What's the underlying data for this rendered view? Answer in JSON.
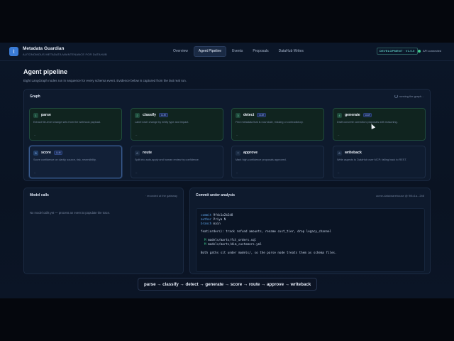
{
  "app": {
    "title": "Metadata Guardian",
    "subtitle": "AUTONOMOUS METADATA MAINTENANCE FOR DATAHUB",
    "logo_glyph": "⌇",
    "env_badge": "DEVELOPMENT · V1.0.0",
    "api_status": "API connected",
    "status_color": "#3ecf8e"
  },
  "nav": {
    "tabs": [
      {
        "label": "Overview",
        "active": false
      },
      {
        "label": "Agent Pipeline",
        "active": true
      },
      {
        "label": "Events",
        "active": false
      },
      {
        "label": "Proposals",
        "active": false
      },
      {
        "label": "DataHub Writes",
        "active": false
      }
    ]
  },
  "page": {
    "title": "Agent pipeline",
    "description": "Eight LangGraph nodes run in sequence for every schema event. Evidence below is captured from the last real run."
  },
  "graph": {
    "label": "Graph",
    "status": "running the graph…",
    "nodes": [
      {
        "num": "1",
        "name": "parse",
        "llm": "",
        "desc": "Extract file-level change sets from the webhook payload.",
        "foot": "–",
        "state": "done"
      },
      {
        "num": "2",
        "name": "classify",
        "llm": "LLM",
        "desc": "Label each change by entity type and impact.",
        "foot": "–",
        "state": "done"
      },
      {
        "num": "3",
        "name": "detect",
        "llm": "LLM",
        "desc": "Find metadata that is now stale, missing or contradictory.",
        "foot": "–",
        "state": "done"
      },
      {
        "num": "4",
        "name": "generate",
        "llm": "LLM",
        "desc": "Draft concrete correction proposals with reasoning.",
        "foot": "–",
        "state": "done"
      },
      {
        "num": "5",
        "name": "score",
        "llm": "LLM",
        "desc": "Score confidence on clarity, source, risk, reversibility.",
        "foot": "–",
        "state": "active"
      },
      {
        "num": "6",
        "name": "route",
        "llm": "",
        "desc": "Split into auto-apply and human review by confidence.",
        "foot": "–",
        "state": "pending"
      },
      {
        "num": "7",
        "name": "approve",
        "llm": "",
        "desc": "Mark high-confidence proposals approved.",
        "foot": "–",
        "state": "pending"
      },
      {
        "num": "8",
        "name": "writeback",
        "llm": "",
        "desc": "Write aspects to DataHub over MCP; falling back to REST.",
        "foot": "–",
        "state": "pending"
      }
    ]
  },
  "model_calls": {
    "label": "Model calls",
    "note": "· recorded at the gateway",
    "empty": "No model calls yet — process an event to populate the trace."
  },
  "commit": {
    "label": "Commit under analysis",
    "note": "acme-data/warehouse @ 9f4c1a...2b8",
    "commit_key": "commit",
    "commit_val": "9f4c1a2b2d8",
    "author_key": "author",
    "author_val": "Priya N",
    "branch_key": "branch",
    "branch_val": "main",
    "message": "feat(orders): track refund amounts, rename cust_tier, drop legacy_channel",
    "files": [
      {
        "mark": "M",
        "path": "models/marts/fct_orders.sql"
      },
      {
        "mark": "M",
        "path": "models/marts/dim_customers.yml"
      }
    ],
    "summary": "Both paths sit under models/, so the parse node treats them as schema files."
  },
  "flow": {
    "text": "parse → classify → detect → generate → score → route → approve → writeback"
  }
}
